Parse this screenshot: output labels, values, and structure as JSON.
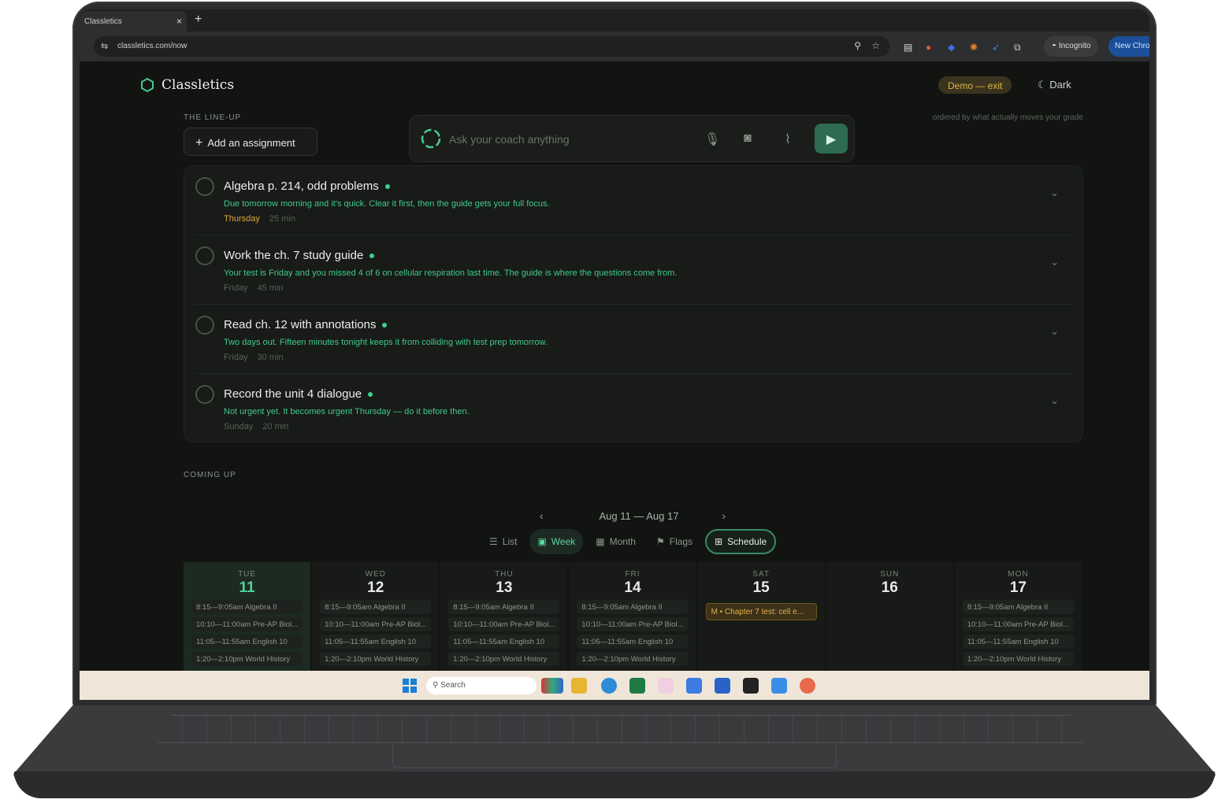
{
  "browser": {
    "tab_title": "Classletics",
    "tab_close": "×",
    "new_tab": "+",
    "url": "classletics.com/now",
    "incognito_label": "Incognito",
    "new_chrome_label": "New Chrome"
  },
  "app": {
    "brand": "Classletics",
    "demo_label": "Demo — exit",
    "dark_label": "Dark",
    "lineup_label": "THE LINE-UP",
    "ordered_note": "ordered by what actually moves your grade",
    "add_assignment": "Add an assignment",
    "coach_placeholder": "Ask your coach anything",
    "coming_up_label": "COMING UP"
  },
  "lineup": [
    {
      "title": "Algebra p. 214, odd problems",
      "reason": "Due tomorrow morning and it's quick. Clear it first, then the guide gets your full focus.",
      "day": "Thursday",
      "duration": "25 min",
      "urgent": true
    },
    {
      "title": "Work the ch. 7 study guide",
      "reason": "Your test is Friday and you missed 4 of 6 on cellular respiration last time. The guide is where the questions come from.",
      "day": "Friday",
      "duration": "45 min",
      "urgent": false
    },
    {
      "title": "Read ch. 12 with annotations",
      "reason": "Two days out. Fifteen minutes tonight keeps it from colliding with test prep tomorrow.",
      "day": "Friday",
      "duration": "30 min",
      "urgent": false
    },
    {
      "title": "Record the unit 4 dialogue",
      "reason": "Not urgent yet. It becomes urgent Thursday — do it before then.",
      "day": "Sunday",
      "duration": "20 min",
      "urgent": false
    }
  ],
  "calendar": {
    "range": "Aug 11 — Aug 17",
    "prev": "‹",
    "next": "›",
    "views": [
      {
        "label": "List",
        "icon": "list-icon",
        "state": "normal"
      },
      {
        "label": "Week",
        "icon": "calendar-icon",
        "state": "active"
      },
      {
        "label": "Month",
        "icon": "calendar-month-icon",
        "state": "normal"
      },
      {
        "label": "Flags",
        "icon": "flag-icon",
        "state": "normal"
      },
      {
        "label": "Schedule",
        "icon": "grid-icon",
        "state": "boxed"
      }
    ],
    "days": [
      {
        "dow": "TUE",
        "num": "11",
        "today": true,
        "events": [
          "8:15—9:05am Algebra II",
          "10:10—11:00am Pre-AP Biol...",
          "11:05—11:55am English 10",
          "1:20—2:10pm World History"
        ]
      },
      {
        "dow": "WED",
        "num": "12",
        "today": false,
        "events": [
          "8:15—9:05am Algebra II",
          "10:10—11:00am Pre-AP Biol...",
          "11:05—11:55am English 10",
          "1:20—2:10pm World History"
        ]
      },
      {
        "dow": "THU",
        "num": "13",
        "today": false,
        "events": [
          "8:15—9:05am Algebra II",
          "10:10—11:00am Pre-AP Biol...",
          "11:05—11:55am English 10",
          "1:20—2:10pm World History"
        ]
      },
      {
        "dow": "FRI",
        "num": "14",
        "today": false,
        "events": [
          "8:15—9:05am Algebra II",
          "10:10—11:00am Pre-AP Biol...",
          "11:05—11:55am English 10",
          "1:20—2:10pm World History"
        ]
      },
      {
        "dow": "SAT",
        "num": "15",
        "today": false,
        "test": "M • Chapter 7 test: cell e...",
        "events": []
      },
      {
        "dow": "SUN",
        "num": "16",
        "today": false,
        "events": []
      },
      {
        "dow": "MON",
        "num": "17",
        "today": false,
        "events": [
          "8:15—9:05am Algebra II",
          "10:10—11:00am Pre-AP Biol...",
          "11:05—11:55am English 10",
          "1:20—2:10pm World History"
        ]
      }
    ]
  },
  "taskbar": {
    "search_label": "Search"
  },
  "colors": {
    "accent": "#3fcf8e",
    "warn": "#e0a83a",
    "background": "#121412"
  }
}
